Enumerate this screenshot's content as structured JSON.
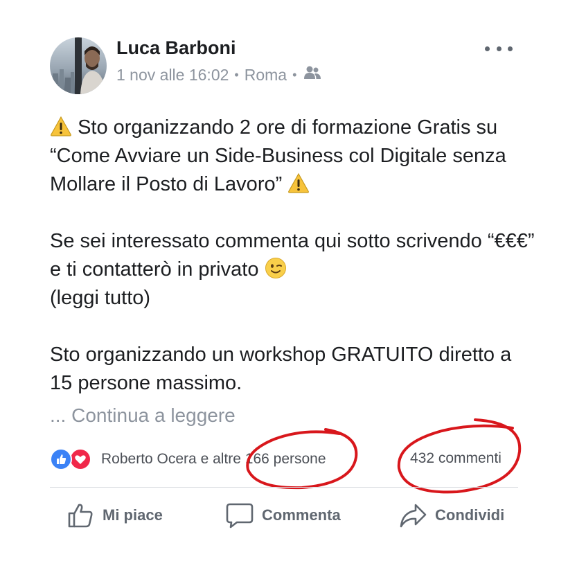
{
  "post": {
    "author": "Luca Barboni",
    "date": "1 nov alle 16:02",
    "location": "Roma",
    "audience_icon": "friends-icon",
    "more_icon": "more-options-icon",
    "paragraph1_a": "Sto organizzando 2 ore di formazione Gratis su “Come Avviare un Side-Business col Digitale senza Mollare il Posto di Lavoro”",
    "paragraph2_a": "Se sei interessato commenta qui sotto scrivendo “€€€” e ti contatterò in privato",
    "paragraph2_b": "(leggi tutto)",
    "paragraph3": "Sto organizzando un workshop GRATUITO diretto a 15 persone massimo.",
    "ellipsis": "...",
    "continue_label": "Continua a leggere"
  },
  "reactions": {
    "summary": "Roberto Ocera e altre 166 persone",
    "icons": [
      "like-icon",
      "love-icon"
    ],
    "comments": "432 commenti"
  },
  "actions": {
    "like": "Mi piace",
    "comment": "Commenta",
    "share": "Condividi"
  },
  "colors": {
    "like_blue": "#3b82f6",
    "love_red": "#f0284a",
    "annotation_red": "#d8171c",
    "text_gray": "#606770"
  }
}
